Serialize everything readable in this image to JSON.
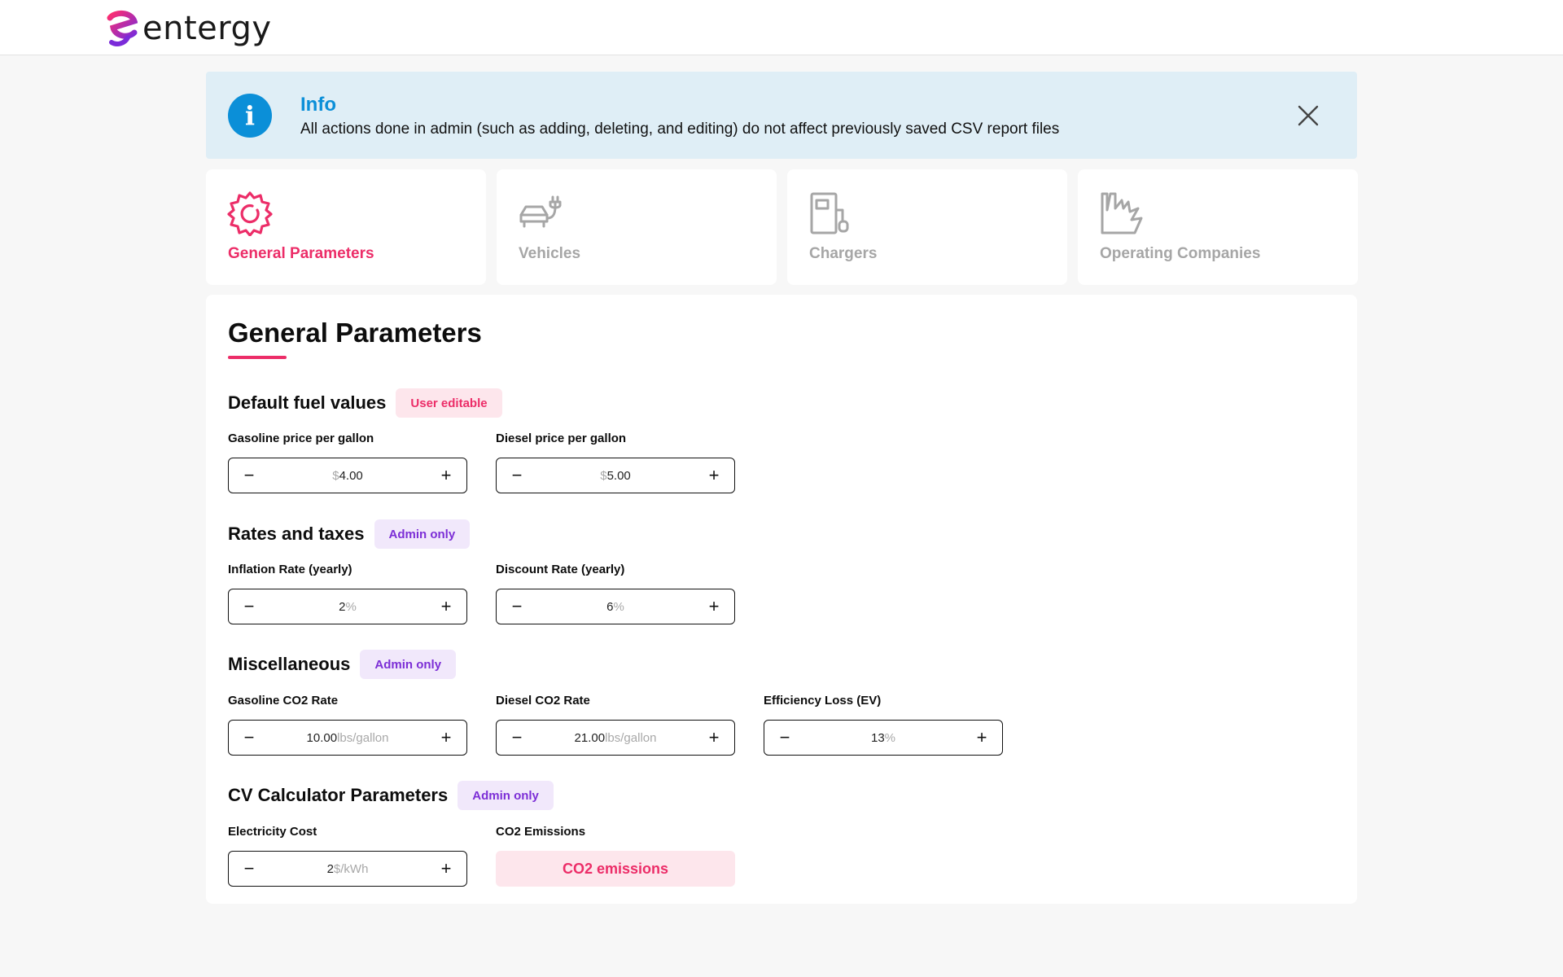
{
  "header": {
    "logo_text": "entergy"
  },
  "info": {
    "title": "Info",
    "message": "All actions done in admin (such as adding, deleting, and editing) do not affect previously saved CSV report files"
  },
  "tabs": [
    {
      "label": "General Parameters",
      "icon": "gear-icon",
      "active": true
    },
    {
      "label": "Vehicles",
      "icon": "vehicle-charging-icon",
      "active": false
    },
    {
      "label": "Chargers",
      "icon": "charger-icon",
      "active": false
    },
    {
      "label": "Operating Companies",
      "icon": "factory-icon",
      "active": false
    }
  ],
  "page": {
    "title": "General Parameters"
  },
  "sections": {
    "fuel": {
      "title": "Default fuel values",
      "badge": "User editable",
      "fields": [
        {
          "label": "Gasoline price per gallon",
          "prefix": "$",
          "value": "4.00",
          "suffix": ""
        },
        {
          "label": "Diesel price per gallon",
          "prefix": "$",
          "value": "5.00",
          "suffix": ""
        }
      ]
    },
    "rates": {
      "title": "Rates and taxes",
      "badge": "Admin only",
      "fields": [
        {
          "label": "Inflation Rate (yearly)",
          "prefix": "",
          "value": "2",
          "suffix": "%"
        },
        {
          "label": "Discount Rate (yearly)",
          "prefix": "",
          "value": "6",
          "suffix": "%"
        }
      ]
    },
    "misc": {
      "title": "Miscellaneous",
      "badge": "Admin only",
      "fields": [
        {
          "label": "Gasoline CO2 Rate",
          "prefix": "",
          "value": "10.00",
          "suffix": "lbs/gallon"
        },
        {
          "label": "Diesel CO2 Rate",
          "prefix": "",
          "value": "21.00",
          "suffix": "lbs/gallon"
        },
        {
          "label": "Efficiency Loss (EV)",
          "prefix": "",
          "value": "13",
          "suffix": "%"
        }
      ]
    },
    "cv": {
      "title": "CV Calculator Parameters",
      "badge": "Admin only",
      "fields": [
        {
          "label": "Electricity Cost",
          "prefix": "",
          "value": "2",
          "suffix": "$/kWh"
        }
      ],
      "co2": {
        "label": "CO2 Emissions",
        "button": "CO2 emissions"
      }
    }
  },
  "stepper": {
    "minus": "−",
    "plus": "+"
  },
  "colors": {
    "accent": "#ec2d68",
    "info_blue": "#0b8fd8",
    "admin_purple": "#7c2ed6",
    "inactive": "#a6a6a6"
  }
}
